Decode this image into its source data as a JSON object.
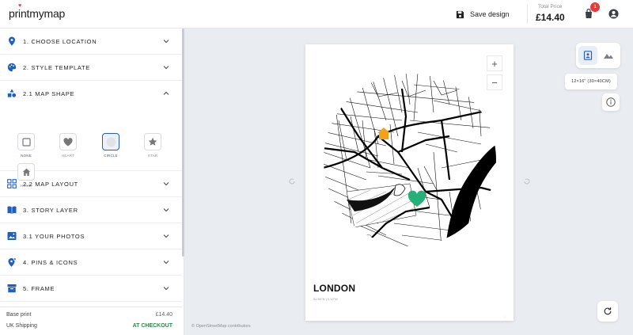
{
  "header": {
    "logo": "printmymap",
    "save_label": "Save design",
    "total_label": "Total Price",
    "total_value": "£14.40",
    "cart_count": "1"
  },
  "sidebar": {
    "sections": [
      {
        "label": "1. CHOOSE LOCATION",
        "icon": "location-pin-icon"
      },
      {
        "label": "2. STYLE TEMPLATE",
        "icon": "palette-icon"
      },
      {
        "label": "2.1 MAP SHAPE",
        "icon": "shapes-icon"
      },
      {
        "label": "2.2 MAP LAYOUT",
        "icon": "layout-grid-icon"
      },
      {
        "label": "3. STORY LAYER",
        "icon": "book-icon"
      },
      {
        "label": "3.1 YOUR PHOTOS",
        "icon": "photos-icon"
      },
      {
        "label": "4. PINS & ICONS",
        "icon": "pin-plus-icon"
      },
      {
        "label": "5. FRAME",
        "icon": "frame-icon"
      }
    ],
    "shapes": [
      {
        "label": "NONE",
        "icon": "square-icon"
      },
      {
        "label": "HEART",
        "icon": "heart-icon"
      },
      {
        "label": "CIRCLE",
        "icon": "circle-icon"
      },
      {
        "label": "STAR",
        "icon": "star-icon"
      },
      {
        "label": "HOME",
        "icon": "home-icon"
      }
    ],
    "selected_shape": "CIRCLE"
  },
  "pricing": {
    "base_label": "Base print",
    "base_value": "£14.40",
    "shipping_label": "UK Shipping",
    "shipping_value": "AT CHECKOUT"
  },
  "canvas": {
    "attribution": "© OpenStreetMap contributors",
    "poster_title": "LONDON",
    "poster_subtitle": "51.50°N | 0.12°W",
    "zoom_in": "+",
    "zoom_out": "−",
    "size_label": "12×16\" (30×40CM)",
    "pins": [
      "home-pin",
      "heart-pin"
    ]
  },
  "colors": {
    "accent": "#2a5fb3",
    "badge": "#e53b3b",
    "home_pin": "#f3a01a",
    "heart_pin": "#25b07a",
    "checkout_green": "#2c8a4a"
  }
}
